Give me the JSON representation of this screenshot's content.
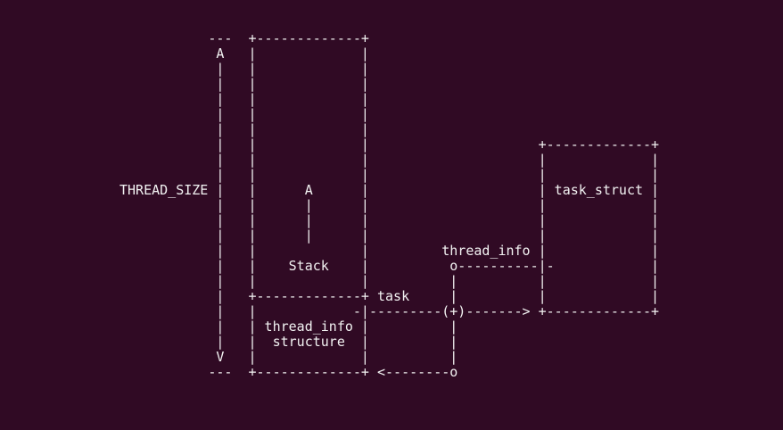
{
  "diagram": {
    "lines": [
      "           ---  +-------------+",
      "            A   |             |",
      "            |   |             |",
      "            |   |             |",
      "            |   |             |",
      "            |   |             |",
      "            |   |             |",
      "            |   |             |                     +-------------+",
      "            |   |             |                     |             |",
      "            |   |             |                     |             |",
      "THREAD_SIZE |   |      A      |                     | task_struct |",
      "            |   |      |      |                     |             |",
      "            |   |      |      |                     |             |",
      "            |   |      |      |                     |             |",
      "            |   |             |         thread_info |             |",
      "            |   |    Stack    |          o----------|-            |",
      "            |   |             |          |          |             |",
      "            |   +-------------+ task     |          |             |",
      "            |   |            -|---------(+)-------> +-------------+",
      "            |   | thread_info |          |",
      "            |   |  structure  |          |",
      "            V   |             |          |",
      "           ---  +-------------+ <--------o"
    ]
  }
}
